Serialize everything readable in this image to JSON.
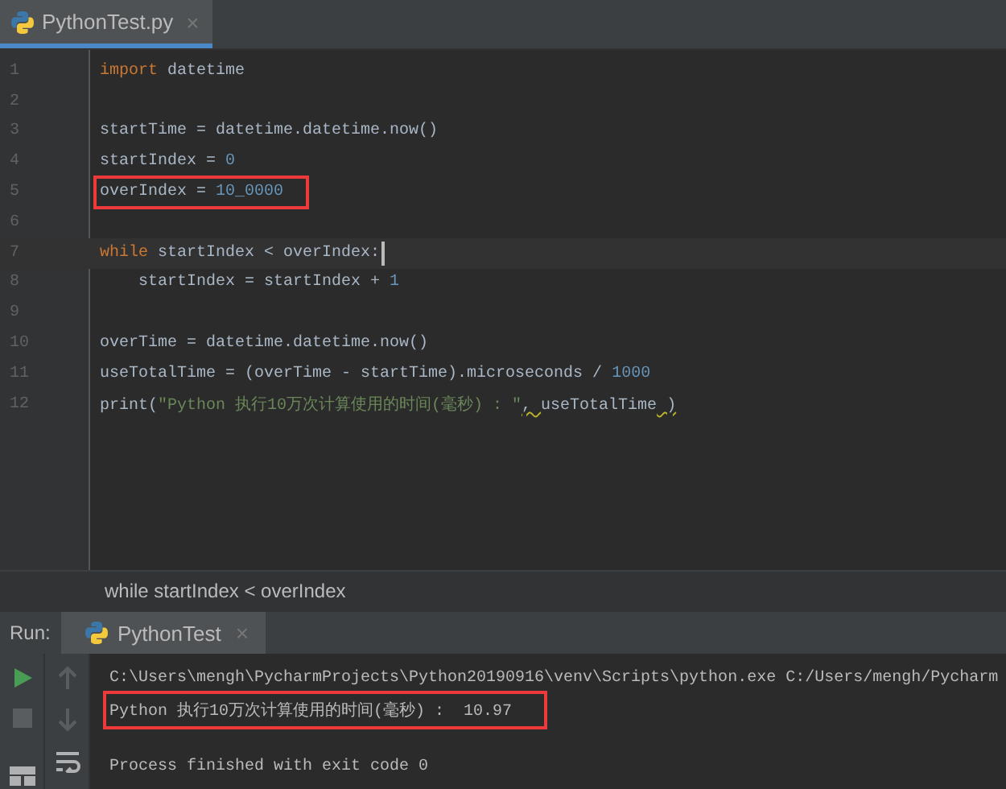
{
  "editor_tabs": [
    {
      "label": "PythonTest.py",
      "selected": true,
      "close": "×"
    }
  ],
  "code_lines": [
    {
      "number": "1",
      "tokens": [
        {
          "kind": "keyword",
          "text": "import"
        },
        {
          "kind": "plain",
          "text": " datetime"
        }
      ]
    },
    {
      "number": "2"
    },
    {
      "number": "3",
      "tokens": [
        {
          "kind": "plain",
          "text": "startTime = datetime.datetime.now()"
        }
      ]
    },
    {
      "number": "4",
      "tokens": [
        {
          "kind": "plain",
          "text": "startIndex = "
        },
        {
          "kind": "number",
          "text": "0"
        }
      ]
    },
    {
      "number": "5",
      "boxed": true,
      "tokens": [
        {
          "kind": "plain",
          "text": "overIndex = "
        },
        {
          "kind": "number",
          "text": "10_0000"
        }
      ]
    },
    {
      "number": "6"
    },
    {
      "number": "7",
      "current": true,
      "tokens": [
        {
          "kind": "keyword",
          "text": "while"
        },
        {
          "kind": "plain",
          "text": " startIndex < overIndex:"
        }
      ]
    },
    {
      "number": "8",
      "tokens": [
        {
          "kind": "plain",
          "text": "    startIndex = startIndex + "
        },
        {
          "kind": "number",
          "text": "1"
        }
      ]
    },
    {
      "number": "9"
    },
    {
      "number": "10",
      "tokens": [
        {
          "kind": "plain",
          "text": "overTime = datetime.datetime.now()"
        }
      ]
    },
    {
      "number": "11",
      "tokens": [
        {
          "kind": "plain",
          "text": "useTotalTime = (overTime - startTime).microseconds / "
        },
        {
          "kind": "number",
          "text": "1000"
        }
      ]
    },
    {
      "number": "12",
      "tokens": [
        {
          "kind": "plain",
          "text": "print("
        },
        {
          "kind": "string",
          "text": "\"Python 执行10万次计算使用的时间(毫秒) : \""
        },
        {
          "kind": "warned",
          "text": ", "
        },
        {
          "kind": "plain",
          "text": "useTotalTime"
        },
        {
          "kind": "warned",
          "text": " )"
        }
      ]
    }
  ],
  "breadcrumb": "while startIndex < overIndex",
  "run_panel": {
    "label": "Run:",
    "tab": {
      "label": "PythonTest",
      "close": "×",
      "selected": true
    },
    "console_lines": [
      {
        "kind": "command",
        "text": "C:\\Users\\mengh\\PycharmProjects\\Python20190916\\venv\\Scripts\\python.exe C:/Users/mengh/Pycharm"
      },
      {
        "kind": "output",
        "boxed": true,
        "text": "Python 执行10万次计算使用的时间(毫秒) :  10.97"
      },
      {
        "kind": "blank"
      },
      {
        "kind": "output",
        "text": "Process finished with exit code 0"
      }
    ]
  }
}
